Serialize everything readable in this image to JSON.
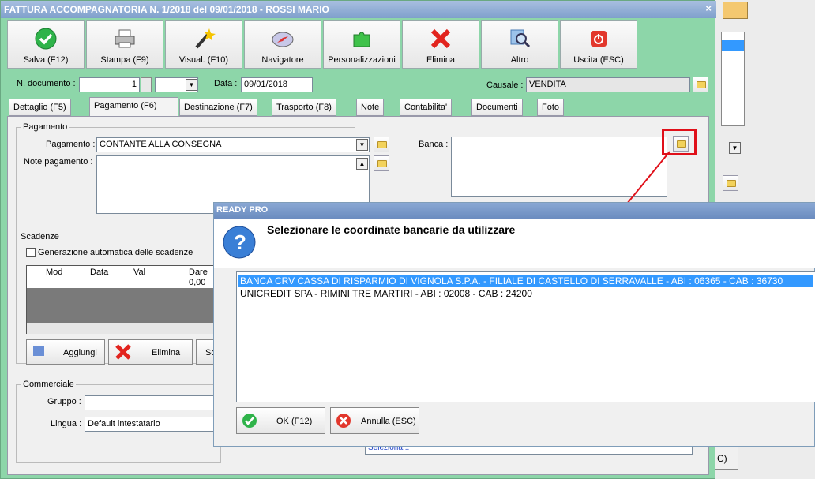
{
  "window": {
    "title": "FATTURA ACCOMPAGNATORIA N. 1/2018 del 09/01/2018 - ROSSI MARIO",
    "close": "×"
  },
  "toolbar": [
    {
      "label": "Salva (F12)",
      "icon": "check-icon"
    },
    {
      "label": "Stampa (F9)",
      "icon": "printer-icon"
    },
    {
      "label": "Visual. (F10)",
      "icon": "magic-wand-icon"
    },
    {
      "label": "Navigatore",
      "icon": "compass-icon"
    },
    {
      "label": "Personalizzazioni",
      "icon": "puzzle-icon"
    },
    {
      "label": "Elimina",
      "icon": "x-icon"
    },
    {
      "label": "Altro",
      "icon": "magnifier-icon"
    },
    {
      "label": "Uscita (ESC)",
      "icon": "power-icon"
    }
  ],
  "header": {
    "ndoc_label": "N. documento :",
    "ndoc_value": "1",
    "data_label": "Data :",
    "data_value": "09/01/2018",
    "causale_label": "Causale :",
    "causale_value": "VENDITA"
  },
  "tabs": [
    "Dettaglio (F5)",
    "Pagamento (F6)",
    "Destinazione (F7)",
    "Trasporto (F8)",
    "Note",
    "Contabilita'",
    "Documenti",
    "Foto"
  ],
  "pagamento": {
    "group": "Pagamento",
    "pag_label": "Pagamento :",
    "pag_value": "CONTANTE ALLA CONSEGNA",
    "note_label": "Note pagamento :",
    "banca_label": "Banca :"
  },
  "scadenze": {
    "group": "Scadenze",
    "auto_label": "Generazione automatica delle scadenze",
    "columns": [
      "Mod",
      "Data",
      "Val",
      "Dare"
    ],
    "row_value": "0,00",
    "add": "Aggiungi",
    "del": "Elimina",
    "third": "So"
  },
  "commerciale": {
    "group": "Commerciale",
    "gruppo_label": "Gruppo :",
    "lingua_label": "Lingua :",
    "lingua_value": "Default intestatario",
    "seleziona": "Seleziona...",
    "right_btn": "C)"
  },
  "dialog": {
    "title": "READY PRO",
    "heading": "Selezionare le coordinate bancarie da utilizzare",
    "items": [
      "BANCA CRV CASSA DI RISPARMIO DI VIGNOLA S.P.A. - FILIALE DI CASTELLO DI SERRAVALLE - ABI : 06365 - CAB : 36730",
      "UNICREDIT SPA - RIMINI TRE MARTIRI - ABI : 02008 - CAB : 24200"
    ],
    "ok": "OK (F12)",
    "cancel": "Annulla (ESC)"
  },
  "colors": {
    "window_bg": "#8dd6a9",
    "selection": "#3399ff",
    "highlight": "#e0101a"
  }
}
